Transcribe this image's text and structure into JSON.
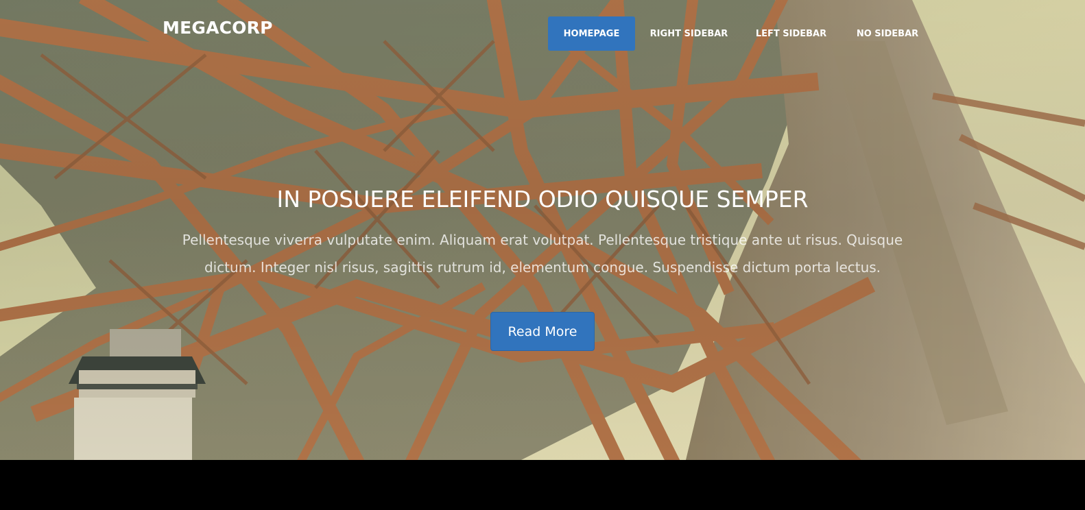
{
  "header": {
    "logo": "MEGACORP"
  },
  "nav": {
    "items": [
      {
        "label": "HOMEPAGE",
        "active": true
      },
      {
        "label": "RIGHT SIDEBAR",
        "active": false
      },
      {
        "label": "LEFT SIDEBAR",
        "active": false
      },
      {
        "label": "NO SIDEBAR",
        "active": false
      }
    ]
  },
  "hero": {
    "title": "IN POSUERE ELEIFEND ODIO QUISQUE SEMPER",
    "text": "Pellentesque viverra vulputate enim. Aliquam erat volutpat. Pellentesque tristique ante ut risus. Quisque dictum. Integer nisl risus, sagittis rutrum id, elementum congue. Suspendisse dictum porta lectus.",
    "button_label": "Read More"
  },
  "colors": {
    "accent": "#3174bd",
    "footer_band": "#000000",
    "steel": "#b06a3e",
    "sky": "#e9e4b6"
  }
}
